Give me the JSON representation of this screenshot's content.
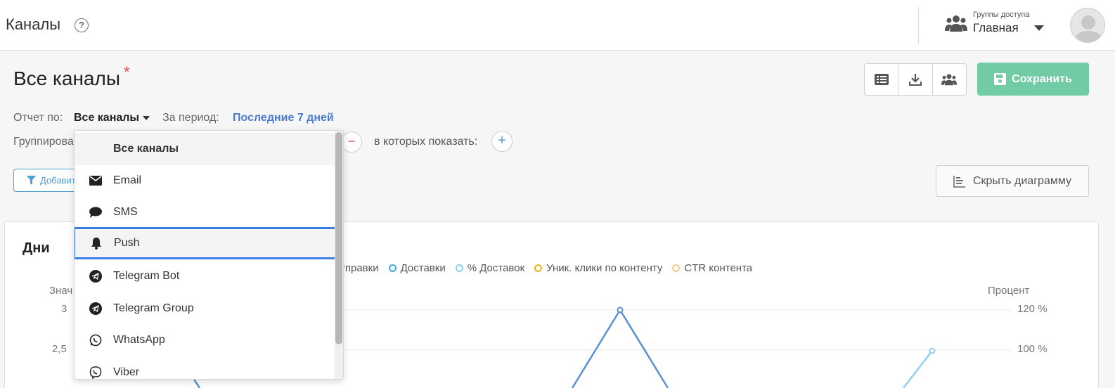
{
  "header": {
    "app_title": "Каналы",
    "help_glyph": "?",
    "access_caption": "Группы доступа",
    "access_value": "Главная"
  },
  "page": {
    "title": "Все каналы",
    "asterisk": "*",
    "save_label": "Сохранить",
    "report_label": "Отчет по:",
    "report_value": "Все каналы",
    "period_label": "За период:",
    "period_value": "Последние 7 дней",
    "group_label": "Группирова",
    "show_label": "в которых показать:",
    "filter_label": "Добавить",
    "hide_chart_label": "Скрыть диаграмму"
  },
  "chart": {
    "title": "Дни",
    "left_axis_label": "Знач",
    "right_axis_label": "Процент",
    "left_ticks": [
      "3",
      "2,5"
    ],
    "right_ticks": [
      "120 %",
      "100 %"
    ],
    "legend": [
      {
        "label": "тправки",
        "color": "#3a6fc4"
      },
      {
        "label": "Доставки",
        "color": "#3fa9e0"
      },
      {
        "label": "% Доставок",
        "color": "#8fd0f2"
      },
      {
        "label": "Уник. клики по контенту",
        "color": "#e8b21c"
      },
      {
        "label": "CTR контента",
        "color": "#f5c98a"
      }
    ]
  },
  "chart_data": {
    "type": "line",
    "title": "Дни",
    "ylabel": "Знач",
    "y2label": "Процент",
    "y_ticks": [
      "3",
      "2,5"
    ],
    "y2_ticks": [
      "120 %",
      "100 %"
    ],
    "series": [
      {
        "name": "Доставки",
        "color": "#5b8fd4",
        "peak_value": 3
      },
      {
        "name": "% Доставок",
        "color": "#8fd0f2",
        "last_value_percent": 100
      }
    ],
    "legend_position": "top"
  },
  "dropdown": {
    "items": [
      {
        "label": "Все каналы",
        "icon": "none"
      },
      {
        "label": "Email",
        "icon": "envelope-icon"
      },
      {
        "label": "SMS",
        "icon": "chat-bubble-icon"
      },
      {
        "label": "Push",
        "icon": "bell-icon"
      },
      {
        "label": "Telegram Bot",
        "icon": "telegram-icon"
      },
      {
        "label": "Telegram Group",
        "icon": "telegram-icon"
      },
      {
        "label": "WhatsApp",
        "icon": "whatsapp-icon"
      },
      {
        "label": "Viber",
        "icon": "viber-icon"
      }
    ],
    "selected": "Push"
  }
}
